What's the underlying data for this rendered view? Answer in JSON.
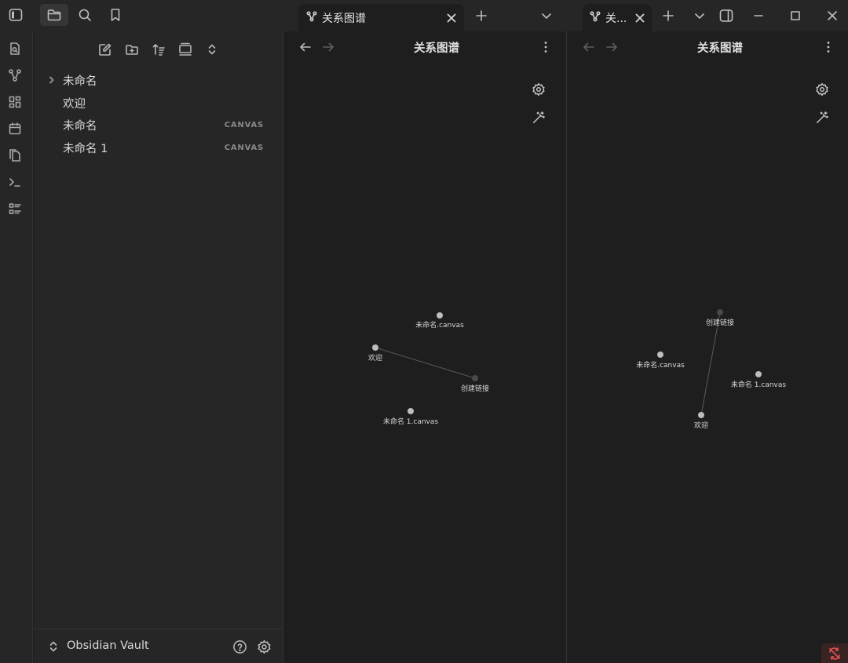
{
  "tabs": {
    "left_tab_title": "关系图谱",
    "right_tab_title": "关..."
  },
  "file_tree": {
    "items": [
      {
        "label": "未命名",
        "badge": "",
        "folder": true
      },
      {
        "label": "欢迎",
        "badge": "",
        "folder": false
      },
      {
        "label": "未命名",
        "badge": "CANVAS",
        "folder": false
      },
      {
        "label": "未命名 1",
        "badge": "CANVAS",
        "folder": false
      }
    ]
  },
  "vault": {
    "name": "Obsidian Vault"
  },
  "left_pane": {
    "title": "关系图谱",
    "nodes": [
      {
        "label": "未命名.canvas"
      },
      {
        "label": "欢迎"
      },
      {
        "label": "创建链接"
      },
      {
        "label": "未命名 1.canvas"
      }
    ]
  },
  "right_pane": {
    "title": "关系图谱",
    "nodes": [
      {
        "label": "创建链接"
      },
      {
        "label": "未命名.canvas"
      },
      {
        "label": "未命名 1.canvas"
      },
      {
        "label": "欢迎"
      }
    ]
  },
  "colors": {
    "background": "#1e1e1e",
    "panel": "#262626",
    "node": "#bdbdbd",
    "unresolved_node": "#4a4a4a",
    "edge": "#5a5a5a",
    "error": "#e05252"
  }
}
